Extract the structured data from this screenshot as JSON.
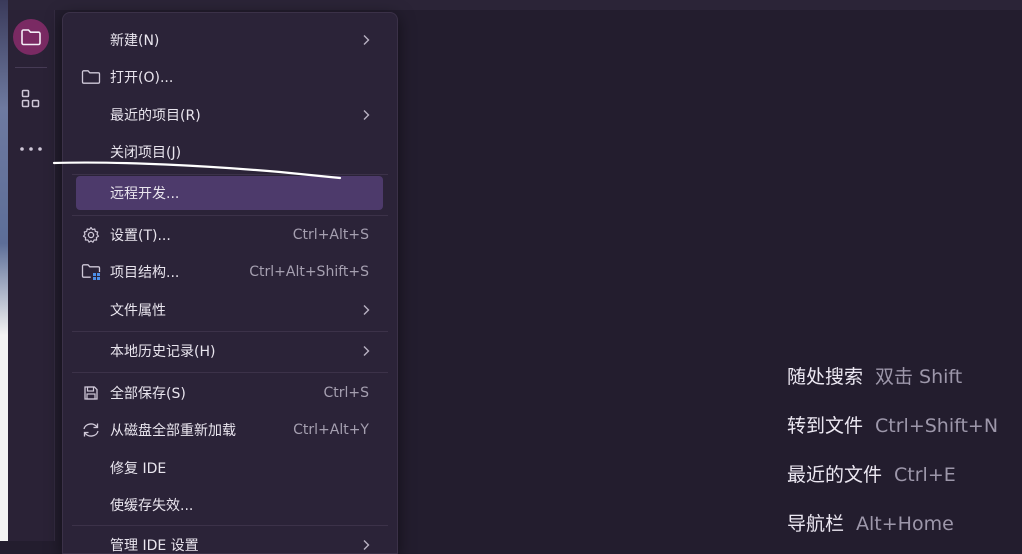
{
  "activity_bar": {
    "project_icon": "folder-icon",
    "structure_icon": "structure-icon",
    "more_icon": "more-horizontal-icon"
  },
  "menu": {
    "items": [
      {
        "label": "新建(N)",
        "shortcut": "",
        "icon": "",
        "submenu": true
      },
      {
        "label": "打开(O)...",
        "shortcut": "",
        "icon": "folder-icon",
        "submenu": false
      },
      {
        "label": "最近的项目(R)",
        "shortcut": "",
        "icon": "",
        "submenu": true
      },
      {
        "label": "关闭项目(J)",
        "shortcut": "",
        "icon": "",
        "submenu": false
      },
      {
        "label": "远程开发...",
        "shortcut": "",
        "icon": "",
        "submenu": false,
        "selected": true
      },
      {
        "label": "设置(T)...",
        "shortcut": "Ctrl+Alt+S",
        "icon": "gear-icon",
        "submenu": false
      },
      {
        "label": "项目结构...",
        "shortcut": "Ctrl+Alt+Shift+S",
        "icon": "project-structure-icon",
        "submenu": false
      },
      {
        "label": "文件属性",
        "shortcut": "",
        "icon": "",
        "submenu": true
      },
      {
        "label": "本地历史记录(H)",
        "shortcut": "",
        "icon": "",
        "submenu": true
      },
      {
        "label": "全部保存(S)",
        "shortcut": "Ctrl+S",
        "icon": "save-icon",
        "submenu": false
      },
      {
        "label": "从磁盘全部重新加载",
        "shortcut": "Ctrl+Alt+Y",
        "icon": "reload-icon",
        "submenu": false
      },
      {
        "label": "修复 IDE",
        "shortcut": "",
        "icon": "",
        "submenu": false
      },
      {
        "label": "使缓存失效...",
        "shortcut": "",
        "icon": "",
        "submenu": false
      },
      {
        "label": "管理 IDE 设置",
        "shortcut": "",
        "icon": "",
        "submenu": true
      }
    ]
  },
  "hints": [
    {
      "label": "随处搜索",
      "keys": "双击 Shift"
    },
    {
      "label": "转到文件",
      "keys": "Ctrl+Shift+N"
    },
    {
      "label": "最近的文件",
      "keys": "Ctrl+E"
    },
    {
      "label": "导航栏",
      "keys": "Alt+Home"
    }
  ],
  "colors": {
    "background": "#231d2e",
    "menu_background": "#2b2338",
    "selected_item": "#4d3a6b",
    "project_badge": "#7a2a63"
  }
}
